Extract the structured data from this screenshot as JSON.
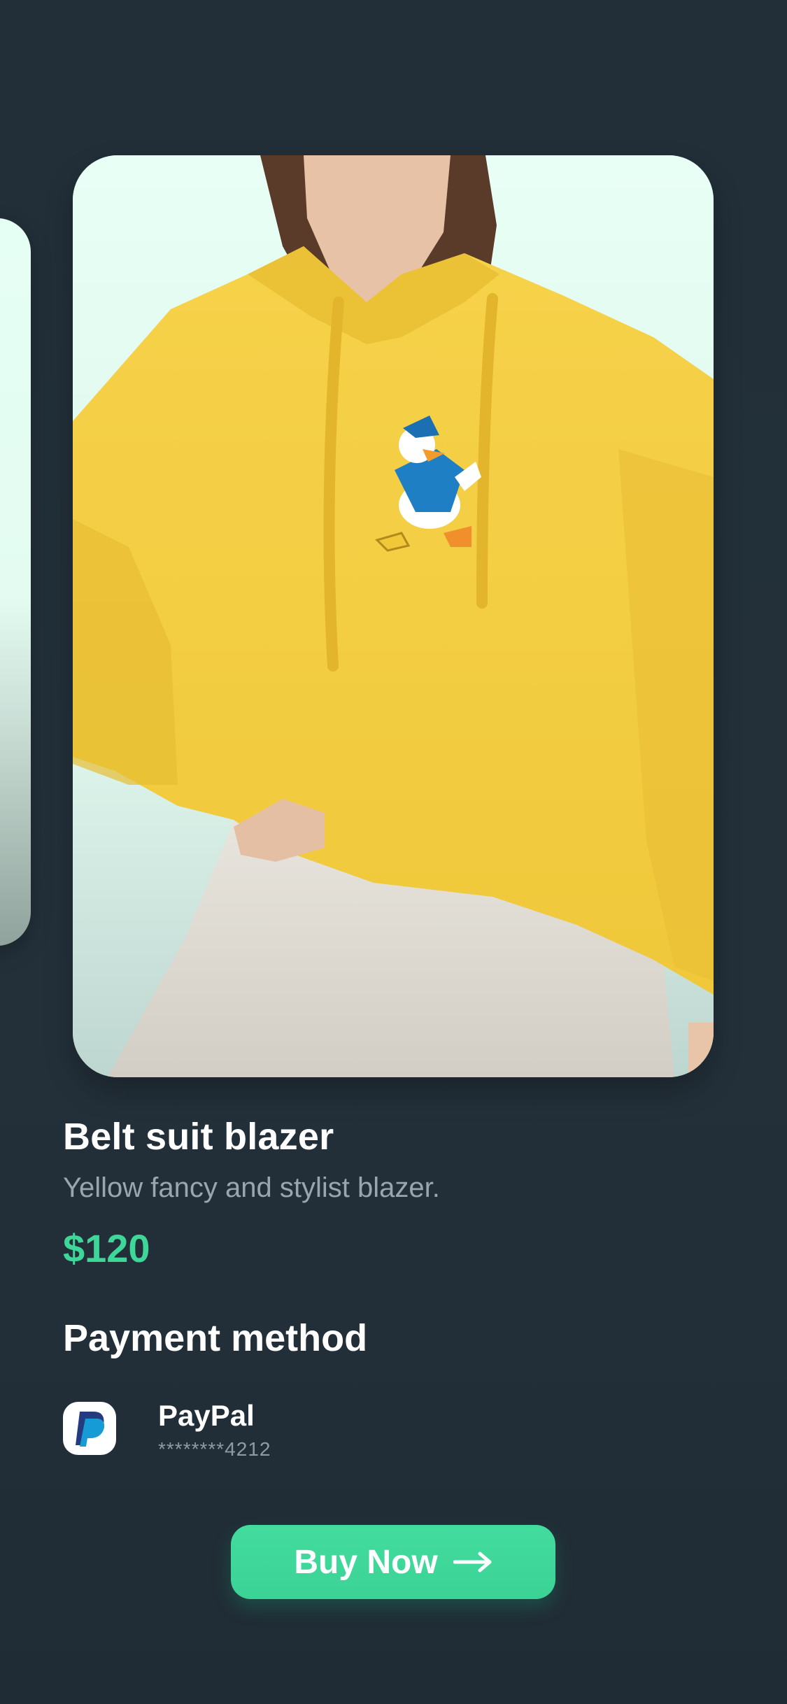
{
  "product": {
    "title": "Belt suit blazer",
    "description": "Yellow fancy and stylist blazer.",
    "price": "$120",
    "image_icon": "product-photo-yellow-hoodie"
  },
  "payment": {
    "section_title": "Payment method",
    "method_name": "PayPal",
    "masked_account": "********4212",
    "icon": "paypal-icon"
  },
  "actions": {
    "buy_label": "Buy Now",
    "buy_icon": "arrow-right-icon"
  },
  "colors": {
    "background": "#222f38",
    "accent": "#3fd69a",
    "muted_text": "#9aa6ae"
  }
}
